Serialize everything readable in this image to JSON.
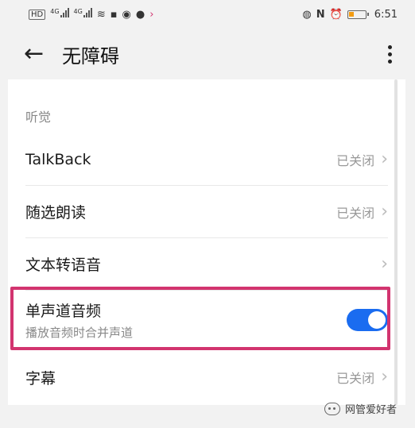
{
  "status_bar": {
    "left_badge": "HD",
    "net1": "4G",
    "net2": "4G",
    "time": "6:51"
  },
  "header": {
    "title": "无障碍"
  },
  "section": {
    "title": "听觉"
  },
  "rows": [
    {
      "label": "TalkBack",
      "value": "已关闭"
    },
    {
      "label": "随选朗读",
      "value": "已关闭"
    },
    {
      "label": "文本转语音",
      "value": ""
    }
  ],
  "mono_audio": {
    "title": "单声道音频",
    "subtitle": "播放音频时合并声道",
    "enabled": true
  },
  "captions": {
    "label": "字幕",
    "value": "已关闭"
  },
  "watermark": {
    "text": "网管爱好者"
  },
  "colors": {
    "accent": "#1a6cf0",
    "highlight": "#d2346f"
  },
  "icons": [
    "back-arrow-icon",
    "more-vert-icon",
    "chevron-right-icon",
    "toggle-switch",
    "wifi-icon",
    "battery-icon",
    "alarm-icon",
    "nfc-icon",
    "wechat-icon"
  ]
}
